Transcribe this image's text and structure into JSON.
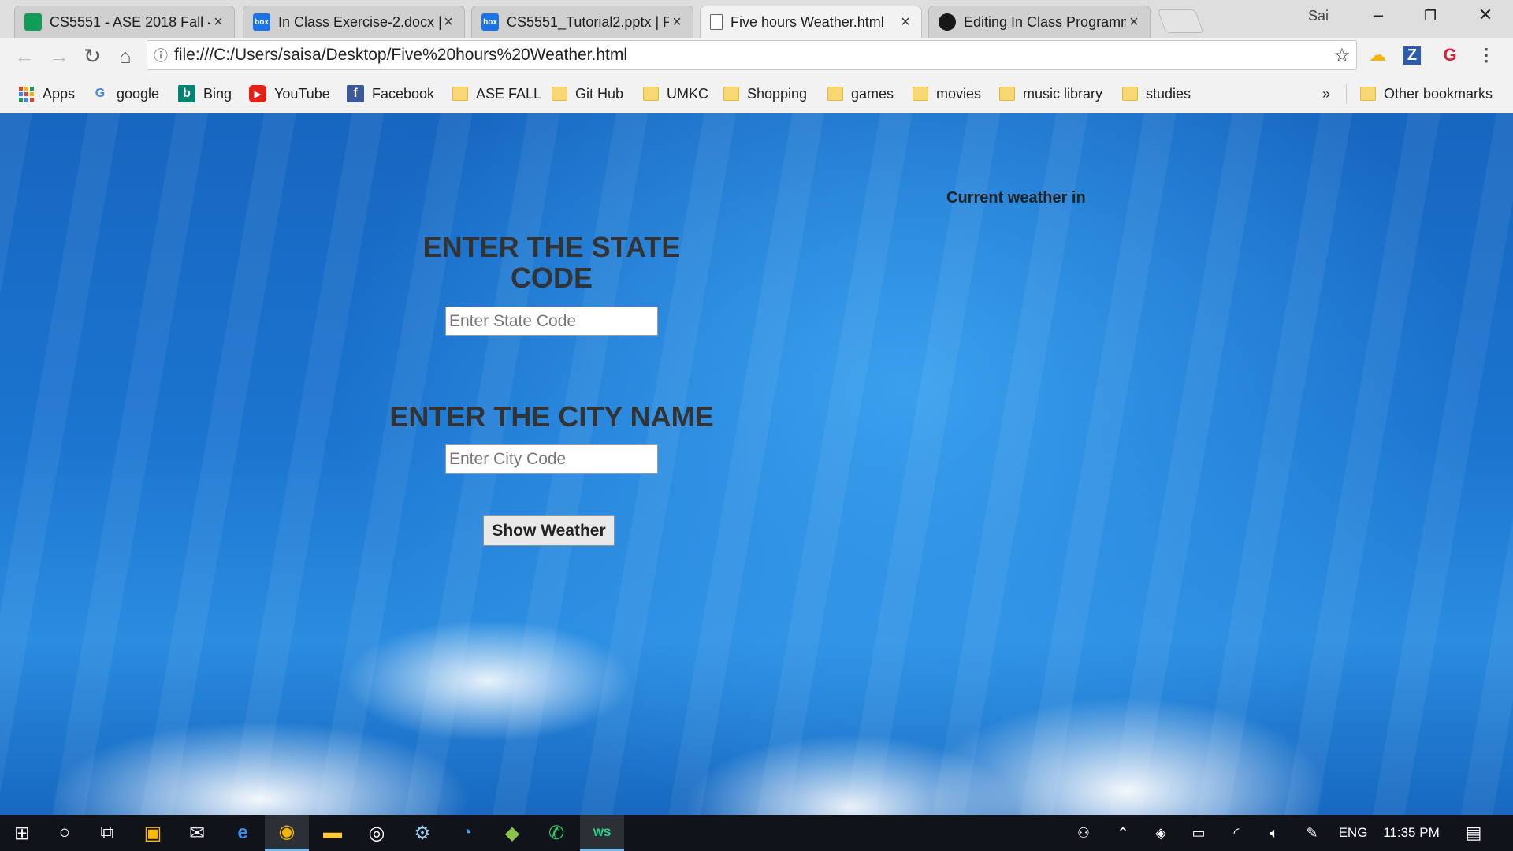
{
  "browser": {
    "tabs": [
      {
        "title": "CS5551 - ASE 2018 Fall - ",
        "icon": "sheets-icon"
      },
      {
        "title": "In Class Exercise-2.docx | ",
        "icon": "box-icon"
      },
      {
        "title": "CS5551_Tutorial2.pptx | P",
        "icon": "box-icon"
      },
      {
        "title": "Five hours Weather.html",
        "icon": "document-icon",
        "active": true
      },
      {
        "title": "Editing In Class Programm",
        "icon": "github-icon"
      }
    ],
    "profile_name": "Sai",
    "address": "file:///C:/Users/saisa/Desktop/Five%20hours%20Weather.html",
    "box_favicon_text": "box",
    "extension_z": "Z",
    "bookmarks": [
      {
        "label": "Apps",
        "icon": "apps-grid-icon"
      },
      {
        "label": "google",
        "icon": "google-icon"
      },
      {
        "label": "Bing",
        "icon": "bing-icon"
      },
      {
        "label": "YouTube",
        "icon": "youtube-icon"
      },
      {
        "label": "Facebook",
        "icon": "facebook-icon"
      },
      {
        "label": "ASE FALL",
        "icon": "folder-icon"
      },
      {
        "label": "Git Hub",
        "icon": "folder-icon"
      },
      {
        "label": "UMKC",
        "icon": "folder-icon"
      },
      {
        "label": "Shopping",
        "icon": "folder-icon"
      },
      {
        "label": "games",
        "icon": "folder-icon"
      },
      {
        "label": "movies",
        "icon": "folder-icon"
      },
      {
        "label": "music library",
        "icon": "folder-icon"
      },
      {
        "label": "studies",
        "icon": "folder-icon"
      }
    ],
    "overflow_label": "»",
    "other_bookmarks": "Other bookmarks"
  },
  "page": {
    "state_heading": "ENTER THE STATE CODE",
    "state_placeholder": "Enter State Code",
    "city_heading": "ENTER THE CITY NAME",
    "city_placeholder": "Enter City Code",
    "button_label": "Show Weather",
    "current_weather_label": "Current weather in"
  },
  "taskbar": {
    "language": "ENG",
    "time": "11:35 PM"
  },
  "colors": {
    "sky_blue": "#1b74cf",
    "heading_text": "#333333",
    "taskbar": "#101319"
  }
}
